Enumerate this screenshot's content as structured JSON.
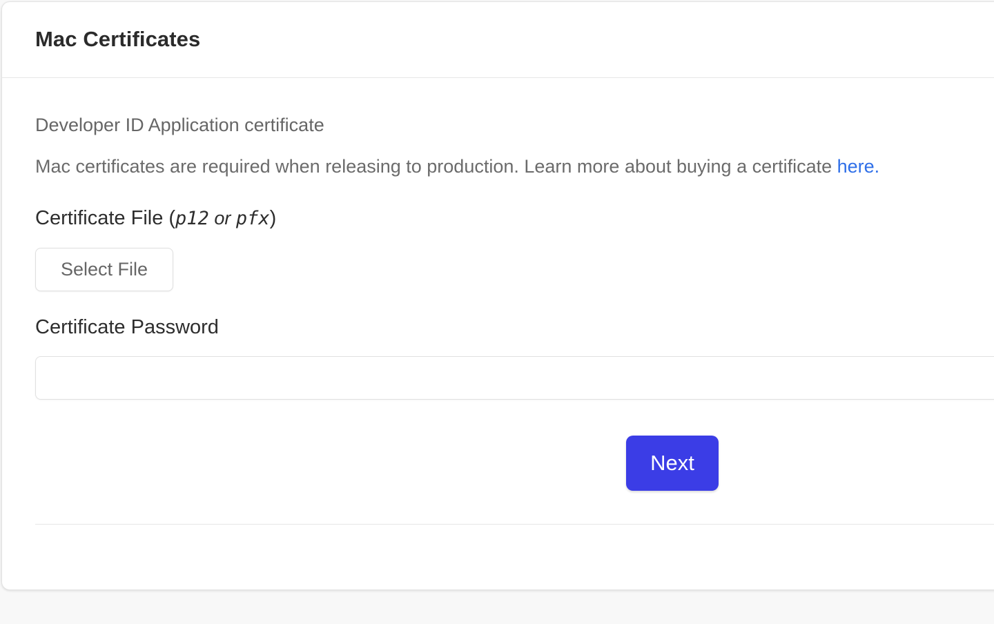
{
  "header": {
    "title": "Mac Certificates"
  },
  "section": {
    "title": "Developer ID Application certificate",
    "description": "Mac certificates are required when releasing to production. Learn more about buying a certificate ",
    "link_label": "here."
  },
  "file_field": {
    "label_prefix": "Certificate File (",
    "ext1": "p12",
    "or_text": " or ",
    "ext2": "pfx",
    "label_suffix": ")",
    "button_label": "Select File"
  },
  "password_field": {
    "label": "Certificate Password",
    "value": "",
    "placeholder": ""
  },
  "actions": {
    "next_label": "Next"
  },
  "colors": {
    "primary": "#3b3de6",
    "link": "#2f6fe8"
  }
}
